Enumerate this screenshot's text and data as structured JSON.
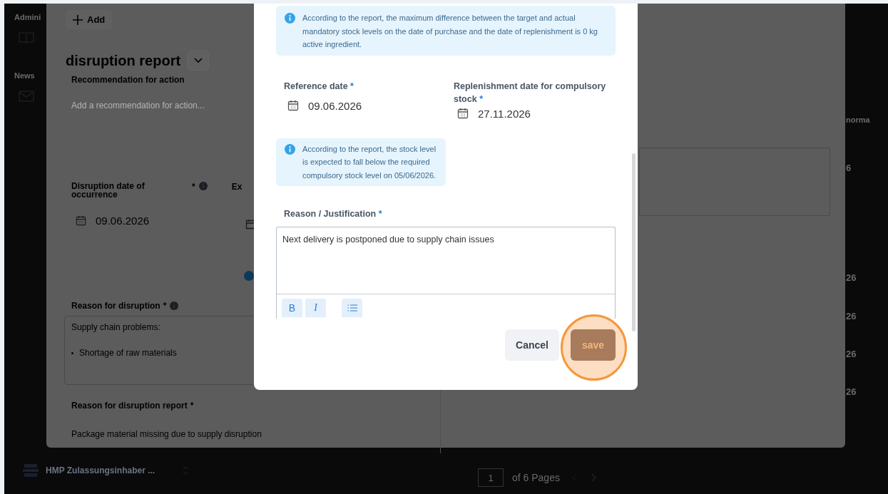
{
  "sidebar": {
    "section_labels": [
      "Admini",
      "News"
    ]
  },
  "account": {
    "name": "HMP Zulassungsinhaber ..."
  },
  "pagination": {
    "page": "1",
    "of_label": "of 6 Pages"
  },
  "background_column": [
    "norma",
    "6",
    "26",
    "26",
    "26",
    "26"
  ],
  "disruption_panel": {
    "add_button": "Add",
    "title": "disruption report",
    "recommendation": {
      "label": "Recommendation for action",
      "placeholder": "Add a recommendation for action..."
    },
    "occurrence": {
      "label": "Disruption date of occurrence",
      "required_mark": "*",
      "value": "09.06.2026"
    },
    "column_2_label": "Ex",
    "reason": {
      "label": "Reason for disruption",
      "required_mark": "*",
      "lines": [
        "Supply chain problems:"
      ],
      "bullets": [
        "Shortage of raw materials"
      ]
    },
    "report_reason": {
      "label": "Reason for disruption report",
      "required_mark": "*",
      "value": "Package material missing due to supply disruption"
    }
  },
  "dialog": {
    "notice": "According to the report, the maximum difference between the target and actual mandatory stock levels on the date of purchase and the date of replenishment is 0 kg active ingredient.",
    "fields": [
      {
        "label": "Reference date",
        "required_mark": "*",
        "value": "09.06.2026"
      },
      {
        "label": "Replenishment date for compulsory stock",
        "required_mark": "*",
        "value": "27.11.2026"
      }
    ],
    "stock_notice": "According to the report, the stock level is expected to fall below the required compulsory stock level on 05/06/2026.",
    "justification": {
      "label": "Reason / Justification",
      "required_mark": "*",
      "value": "Next delivery is postponed due to supply chain issues"
    },
    "toolbar": [
      {
        "kind": "bold",
        "label": "B"
      },
      {
        "kind": "italic",
        "label": "I"
      },
      {
        "kind": "list"
      }
    ],
    "buttons": [
      {
        "kind": "secondary",
        "label": "Cancel",
        "highlighted": false
      },
      {
        "kind": "primary",
        "label": "save",
        "highlighted": true
      }
    ]
  }
}
